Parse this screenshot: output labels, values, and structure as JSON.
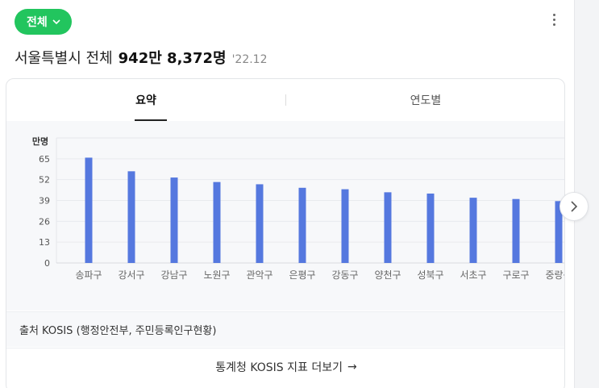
{
  "filter": {
    "label": "전체"
  },
  "headline": {
    "region": "서울특별시 전체",
    "total": "942만 8,372명",
    "date": "'22.12"
  },
  "tabs": [
    {
      "label": "요약"
    },
    {
      "label": "연도별"
    }
  ],
  "chart_data": {
    "type": "bar",
    "unit_label": "만명",
    "categories": [
      "송파구",
      "강서구",
      "강남구",
      "노원구",
      "관악구",
      "은평구",
      "강동구",
      "양천구",
      "성북구",
      "서초구",
      "구로구",
      "중랑구"
    ],
    "values": [
      65.7,
      57.2,
      53.3,
      50.5,
      49.1,
      46.9,
      46.0,
      44.1,
      43.3,
      40.7,
      39.9,
      38.6
    ],
    "y_ticks": [
      0,
      13,
      26,
      39,
      52,
      65
    ],
    "ylim": [
      0,
      78
    ],
    "grid": true,
    "colors": {
      "bar": "#5578df"
    }
  },
  "source": {
    "text": "출처 KOSIS (행정안전부, 주민등록인구현황)"
  },
  "more_link": {
    "label": "통계청 KOSIS 지표 더보기",
    "arrow": "→"
  }
}
